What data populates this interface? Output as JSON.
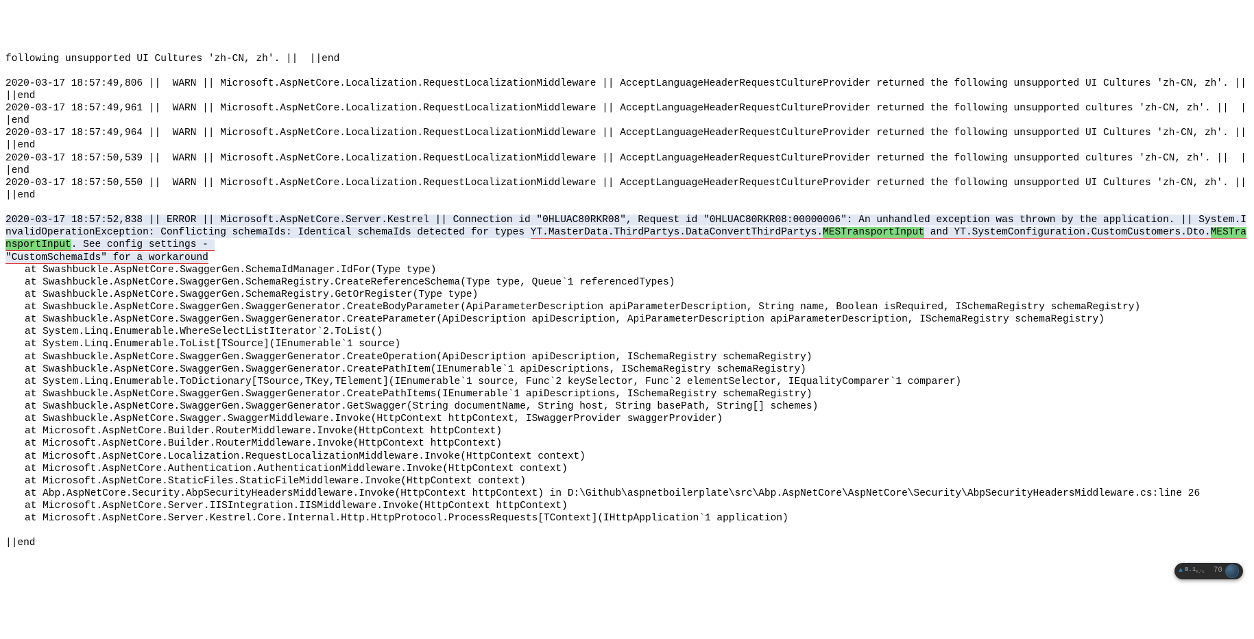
{
  "truncated_first": "following unsupported UI Cultures 'zh-CN, zh'. ||  ||end",
  "warn_lines": [
    "2020-03-17 18:57:49,806 ||  WARN || Microsoft.AspNetCore.Localization.RequestLocalizationMiddleware || AcceptLanguageHeaderRequestCultureProvider returned the following unsupported UI Cultures 'zh-CN, zh'. ||  ||end",
    "2020-03-17 18:57:49,961 ||  WARN || Microsoft.AspNetCore.Localization.RequestLocalizationMiddleware || AcceptLanguageHeaderRequestCultureProvider returned the following unsupported cultures 'zh-CN, zh'. ||  ||end",
    "2020-03-17 18:57:49,964 ||  WARN || Microsoft.AspNetCore.Localization.RequestLocalizationMiddleware || AcceptLanguageHeaderRequestCultureProvider returned the following unsupported UI Cultures 'zh-CN, zh'. ||  ||end",
    "2020-03-17 18:57:50,539 ||  WARN || Microsoft.AspNetCore.Localization.RequestLocalizationMiddleware || AcceptLanguageHeaderRequestCultureProvider returned the following unsupported cultures 'zh-CN, zh'. ||  ||end",
    "2020-03-17 18:57:50,550 ||  WARN || Microsoft.AspNetCore.Localization.RequestLocalizationMiddleware || AcceptLanguageHeaderRequestCultureProvider returned the following unsupported UI Cultures 'zh-CN, zh'. ||  ||end"
  ],
  "error": {
    "prefix": "2020-03-17 18:57:52,838 || ERROR || Microsoft.AspNetCore.Server.Kestrel || Connection id \"0HLUAC80RKR08\", Request id \"0HLUAC80RKR08:00000006\": An unhandled exception was thrown by the application. || System.InvalidOperationException: Conflicting schemaIds: Identical schemaIds detected for types ",
    "underlined1_pre": "YT.MasterData.ThirdPartys.DataConvertThirdPartys.",
    "highlight1": "MESTransportInput",
    "mid": " and YT.SystemConfiguration.CustomCustomers.Dto.",
    "highlight2": "MESTransportInput",
    "after_highlight2": ". See config settings - ",
    "underlined2": "\"CustomSchemaIds\" for a workaround"
  },
  "stack": [
    "at Swashbuckle.AspNetCore.SwaggerGen.SchemaIdManager.IdFor(Type type)",
    "at Swashbuckle.AspNetCore.SwaggerGen.SchemaRegistry.CreateReferenceSchema(Type type, Queue`1 referencedTypes)",
    "at Swashbuckle.AspNetCore.SwaggerGen.SchemaRegistry.GetOrRegister(Type type)",
    "at Swashbuckle.AspNetCore.SwaggerGen.SwaggerGenerator.CreateBodyParameter(ApiParameterDescription apiParameterDescription, String name, Boolean isRequired, ISchemaRegistry schemaRegistry)",
    "at Swashbuckle.AspNetCore.SwaggerGen.SwaggerGenerator.CreateParameter(ApiDescription apiDescription, ApiParameterDescription apiParameterDescription, ISchemaRegistry schemaRegistry)",
    "at System.Linq.Enumerable.WhereSelectListIterator`2.ToList()",
    "at System.Linq.Enumerable.ToList[TSource](IEnumerable`1 source)",
    "at Swashbuckle.AspNetCore.SwaggerGen.SwaggerGenerator.CreateOperation(ApiDescription apiDescription, ISchemaRegistry schemaRegistry)",
    "at Swashbuckle.AspNetCore.SwaggerGen.SwaggerGenerator.CreatePathItem(IEnumerable`1 apiDescriptions, ISchemaRegistry schemaRegistry)",
    "at System.Linq.Enumerable.ToDictionary[TSource,TKey,TElement](IEnumerable`1 source, Func`2 keySelector, Func`2 elementSelector, IEqualityComparer`1 comparer)",
    "at Swashbuckle.AspNetCore.SwaggerGen.SwaggerGenerator.CreatePathItems(IEnumerable`1 apiDescriptions, ISchemaRegistry schemaRegistry)",
    "at Swashbuckle.AspNetCore.SwaggerGen.SwaggerGenerator.GetSwagger(String documentName, String host, String basePath, String[] schemes)",
    "at Swashbuckle.AspNetCore.Swagger.SwaggerMiddleware.Invoke(HttpContext httpContext, ISwaggerProvider swaggerProvider)",
    "at Microsoft.AspNetCore.Builder.RouterMiddleware.Invoke(HttpContext httpContext)",
    "at Microsoft.AspNetCore.Builder.RouterMiddleware.Invoke(HttpContext httpContext)",
    "at Microsoft.AspNetCore.Localization.RequestLocalizationMiddleware.Invoke(HttpContext context)",
    "at Microsoft.AspNetCore.Authentication.AuthenticationMiddleware.Invoke(HttpContext context)",
    "at Microsoft.AspNetCore.StaticFiles.StaticFileMiddleware.Invoke(HttpContext context)",
    "at Abp.AspNetCore.Security.AbpSecurityHeadersMiddleware.Invoke(HttpContext httpContext) in D:\\Github\\aspnetboilerplate\\src\\Abp.AspNetCore\\AspNetCore\\Security\\AbpSecurityHeadersMiddleware.cs:line 26",
    "at Microsoft.AspNetCore.Server.IISIntegration.IISMiddleware.Invoke(HttpContext httpContext)",
    "at Microsoft.AspNetCore.Server.Kestrel.Core.Internal.Http.HttpProtocol.ProcessRequests[TContext](IHttpApplication`1 application)"
  ],
  "end_marker": "||end",
  "widget": {
    "speed_value": "0.1",
    "speed_unit": "K/s",
    "percent": "70"
  }
}
